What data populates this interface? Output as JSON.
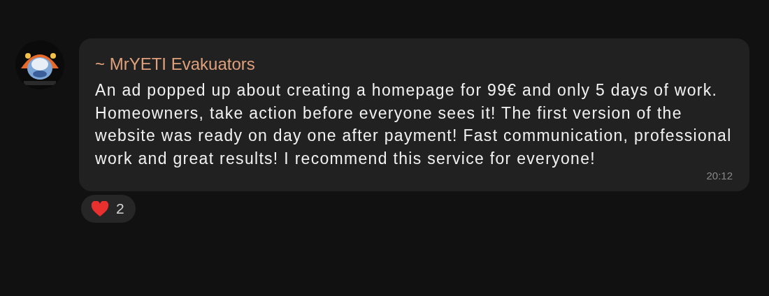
{
  "message": {
    "sender": "~ MrYETI Evakuators",
    "text": "An ad popped up about creating a homepage for 99€ and only 5 days of work. Homeowners, take action before everyone sees it! The first version of the website was ready on day one after payment! Fast communication, professional work and great results! I recommend this service for everyone!",
    "time": "20:12"
  },
  "reactions": [
    {
      "kind": "heart",
      "count": "2"
    }
  ]
}
